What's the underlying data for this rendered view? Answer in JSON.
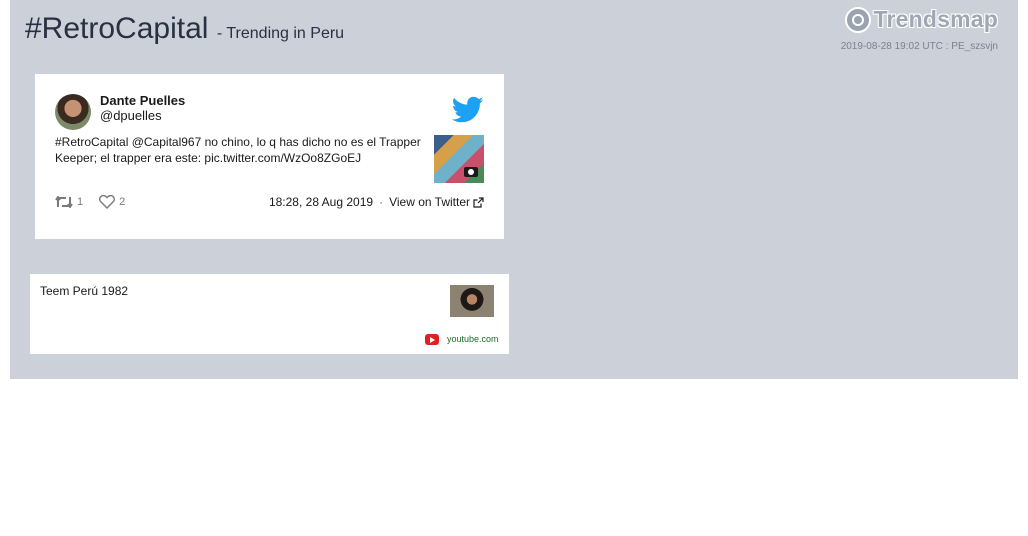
{
  "header": {
    "hashtag": "#RetroCapital",
    "subtitle": "- Trending in Peru",
    "logo_text": "Trendsmap",
    "timestamp": "2019-08-28 19:02 UTC : PE_szsvjn"
  },
  "tweet": {
    "author_name": "Dante Puelles",
    "author_handle": "@dpuelles",
    "text_line1": "#RetroCapital @Capital967 no chino, lo q has dicho no es el Trapper",
    "text_line2": "Keeper; el trapper era este: pic.twitter.com/WzOo8ZGoEJ",
    "retweets": "1",
    "likes": "2",
    "time": "18:28, 28 Aug 2019",
    "separator": "·",
    "view_link": "View on Twitter"
  },
  "link_card": {
    "title": "Teem Perú 1982",
    "domain": "youtube.com"
  },
  "colors": {
    "panel_bg": "#ccd0d9",
    "twitter_blue": "#1da1f2",
    "youtube_red": "#e02020",
    "domain_green": "#1f6b2b"
  },
  "icons": [
    "trendsmap-logo-icon",
    "twitter-bird-icon",
    "camera-icon",
    "retweet-icon",
    "heart-icon",
    "external-link-icon",
    "youtube-icon"
  ]
}
